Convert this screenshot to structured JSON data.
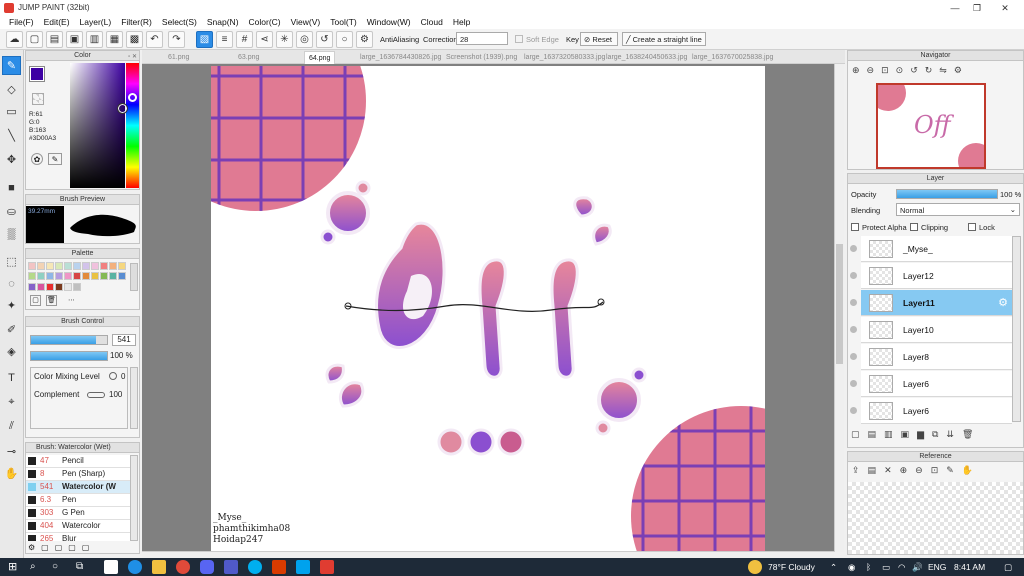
{
  "window": {
    "title": "JUMP PAINT (32bit)"
  },
  "menu": [
    "File(F)",
    "Edit(E)",
    "Layer(L)",
    "Filter(R)",
    "Select(S)",
    "Snap(N)",
    "Color(C)",
    "View(V)",
    "Tool(T)",
    "Window(W)",
    "Cloud",
    "Help"
  ],
  "toolbar": {
    "antialiasing_label": "AntiAliasing",
    "correction_label": "Correction",
    "correction_value": "28",
    "soft_edge_label": "Soft Edge",
    "key_label": "Key",
    "reset_label": "Reset",
    "straight_line_label": "Create a straight line"
  },
  "color_panel": {
    "title": "Color",
    "r": "R:61",
    "g": "G:0",
    "b": "B:163",
    "hex": "#3D00A3",
    "main_color": "#3d00a3"
  },
  "brush_preview": {
    "title": "Brush Preview",
    "size": "39.27mm"
  },
  "palette": {
    "title": "Palette",
    "colors": [
      "#f2c4c4",
      "#f3d3b4",
      "#f6e7b7",
      "#d8e9b8",
      "#b9dfd5",
      "#b9d2ee",
      "#d3c3ea",
      "#f0c1dd",
      "#f08080",
      "#f3b07c",
      "#f5d77f",
      "#b5d98a",
      "#8fd0c3",
      "#8fb6e6",
      "#b59ce0",
      "#ef96c6",
      "#d64545",
      "#e28a3b",
      "#e9c243",
      "#85b955",
      "#5ab3a2",
      "#5a8dd1",
      "#8563c9",
      "#d8559e",
      "#e82e2e",
      "#7a3a1e",
      "#e8e8e8",
      "#c0c0c0"
    ]
  },
  "brush_control": {
    "title": "Brush Control",
    "size": "541",
    "opacity": "100 %",
    "opacity_fraction": 1.0,
    "size_fraction": 0.86,
    "mixing_label": "Color Mixing Level",
    "mixing_value": "0",
    "complement_label": "Complement",
    "complement_value": "100"
  },
  "brush_list": {
    "title": "Brush: Watercolor (Wet)",
    "items": [
      {
        "size": "47",
        "name": "Pencil",
        "selected": false
      },
      {
        "size": "8",
        "name": "Pen (Sharp)",
        "selected": false
      },
      {
        "size": "541",
        "name": "Watercolor (W",
        "selected": true
      },
      {
        "size": "6.3",
        "name": "Pen",
        "selected": false
      },
      {
        "size": "303",
        "name": "G Pen",
        "selected": false
      },
      {
        "size": "404",
        "name": "Watercolor",
        "selected": false
      },
      {
        "size": "265",
        "name": "Blur",
        "selected": false
      }
    ]
  },
  "tabs": [
    {
      "label": "61.png",
      "active": false
    },
    {
      "label": "63.png",
      "active": false
    },
    {
      "label": "64.png",
      "active": true
    },
    {
      "label": "large_1636784430826.jpg",
      "active": false
    },
    {
      "label": "Screenshot (1939).png",
      "active": false
    },
    {
      "label": "large_1637320580333.jpg",
      "active": false
    },
    {
      "label": "large_1638240450633.jpg",
      "active": false
    },
    {
      "label": "large_1637670025838.jpg",
      "active": false
    }
  ],
  "canvas": {
    "signature_line1": "_Myse_",
    "signature_line2": "phamthikimha08",
    "signature_line3": "Hoidap247",
    "accent_pink": "#e07a93",
    "accent_purple": "#8a4fc4",
    "grid_color": "#7b3fb4"
  },
  "navigator": {
    "title": "Navigator"
  },
  "layer_panel": {
    "title": "Layer",
    "opacity_label": "Opacity",
    "opacity_value": "100 %",
    "opacity_fraction": 1.0,
    "blending_label": "Blending",
    "blending_value": "Normal",
    "protect_alpha": "Protect Alpha",
    "clipping": "Clipping",
    "lock": "Lock",
    "layers": [
      {
        "name": "_Myse_",
        "selected": false
      },
      {
        "name": "Layer12",
        "selected": false
      },
      {
        "name": "Layer11",
        "selected": true
      },
      {
        "name": "Layer10",
        "selected": false
      },
      {
        "name": "Layer8",
        "selected": false
      },
      {
        "name": "Layer6",
        "selected": false
      },
      {
        "name": "Layer6",
        "selected": false
      }
    ]
  },
  "reference": {
    "title": "Reference"
  },
  "taskbar": {
    "weather": "78°F Cloudy",
    "lang": "ENG",
    "time": "8:41 AM"
  }
}
